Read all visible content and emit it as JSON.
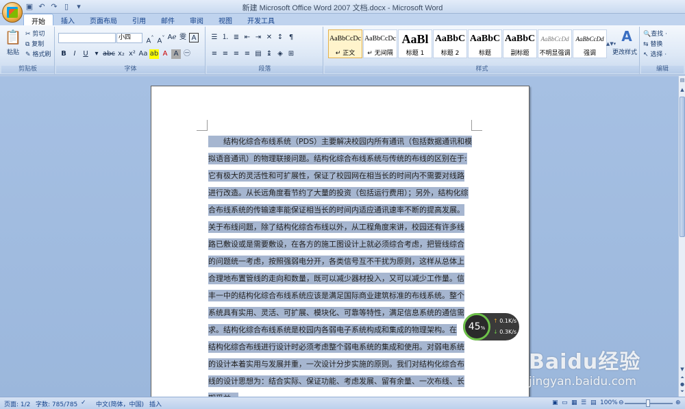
{
  "title": "新建 Microsoft Office Word 2007 文档.docx - Microsoft Word",
  "qat_icons": [
    "save-icon",
    "undo-icon",
    "redo-icon",
    "new-doc-icon",
    "customize-icon"
  ],
  "tabs": [
    "开始",
    "插入",
    "页面布局",
    "引用",
    "邮件",
    "审阅",
    "视图",
    "开发工具"
  ],
  "active_tab": "开始",
  "clipboard": {
    "paste": "粘贴",
    "cut": "剪切",
    "copy": "复制",
    "format_painter": "格式刷",
    "label": "剪贴板"
  },
  "font": {
    "name_value": "",
    "size_value": "小四",
    "label": "字体"
  },
  "paragraph": {
    "label": "段落"
  },
  "styles": {
    "label": "样式",
    "items": [
      {
        "sample": "AaBbCcDc",
        "name": "↵ 正文"
      },
      {
        "sample": "AaBbCcDc",
        "name": "↵ 无间隔"
      },
      {
        "sample": "AaBl",
        "name": "标题 1"
      },
      {
        "sample": "AaBbC",
        "name": "标题 2"
      },
      {
        "sample": "AaBbC",
        "name": "标题"
      },
      {
        "sample": "AaBbC",
        "name": "副标题"
      },
      {
        "sample": "AaBbCcDd",
        "name": "不明显强调"
      },
      {
        "sample": "AaBbCcDd",
        "name": "强调"
      }
    ],
    "change_styles": "更改样式"
  },
  "editing": {
    "find": "查找 ·",
    "replace": "替换",
    "select": "选择 ·",
    "label": "编辑"
  },
  "document": {
    "lines": [
      "　　结构化综合布线系统（PDS）主要解决校园内所有通讯（包括数据通讯和模",
      "拟语音通讯）的物理联接问题。结构化综合布线系统与传统的布线的区别在于:",
      "它有极大的灵活性和可扩展性，保证了校园网在相当长的时间内不需要对线路",
      "进行改造。从长远角度看节约了大量的投资（包括运行费用）；另外，结构化综",
      "合布线系统的传输速率能保证相当长的时间内适应通讯速率不断的提高发展。",
      "关于布线问题，除了结构化综合布线以外，从工程角度来讲，校园还有许多线",
      "路已敷设或是需要敷设，在各方的施工图设计上就必须综合考虑，把管线综合",
      "的问题统一考虑，按照强弱电分开，各类信号互不干扰为原则，这样从总体上",
      "合理地布置管线的走向和数量，既可以减少器材投入，又可以减少工作量。信",
      "丰一中的结构化综合布线系统应该是满足国际商业建筑标准的布线系统。整个",
      "系统具有实用、灵活、可扩展、模块化、可靠等特性，满足信息系统的通信需",
      "求。结构化综合布线系统是校园内各弱电子系统构成和集成的物理架构。在",
      "结构化综合布线进行设计时必须考虑整个弱电系统的集成和使用。对弱电系统",
      "的设计本着实用与发展并重，一次设计分步实施的原则。我们对结构化综合布",
      "线的设计思想为：结合实际、保证功能、考虑发展、留有余量、一次布线、长",
      "期受益。"
    ]
  },
  "network_widget": {
    "percent": "45",
    "percent_unit": "%",
    "up": "0.1K/s",
    "down": "0.3K/s"
  },
  "watermark": {
    "brand": "Baidu经验",
    "url": "jingyan.baidu.com"
  },
  "status": {
    "page": "页面: 1/2",
    "words": "字数: 785/785",
    "language": "中文(简体，中国)",
    "mode": "插入",
    "zoom": "100%"
  }
}
